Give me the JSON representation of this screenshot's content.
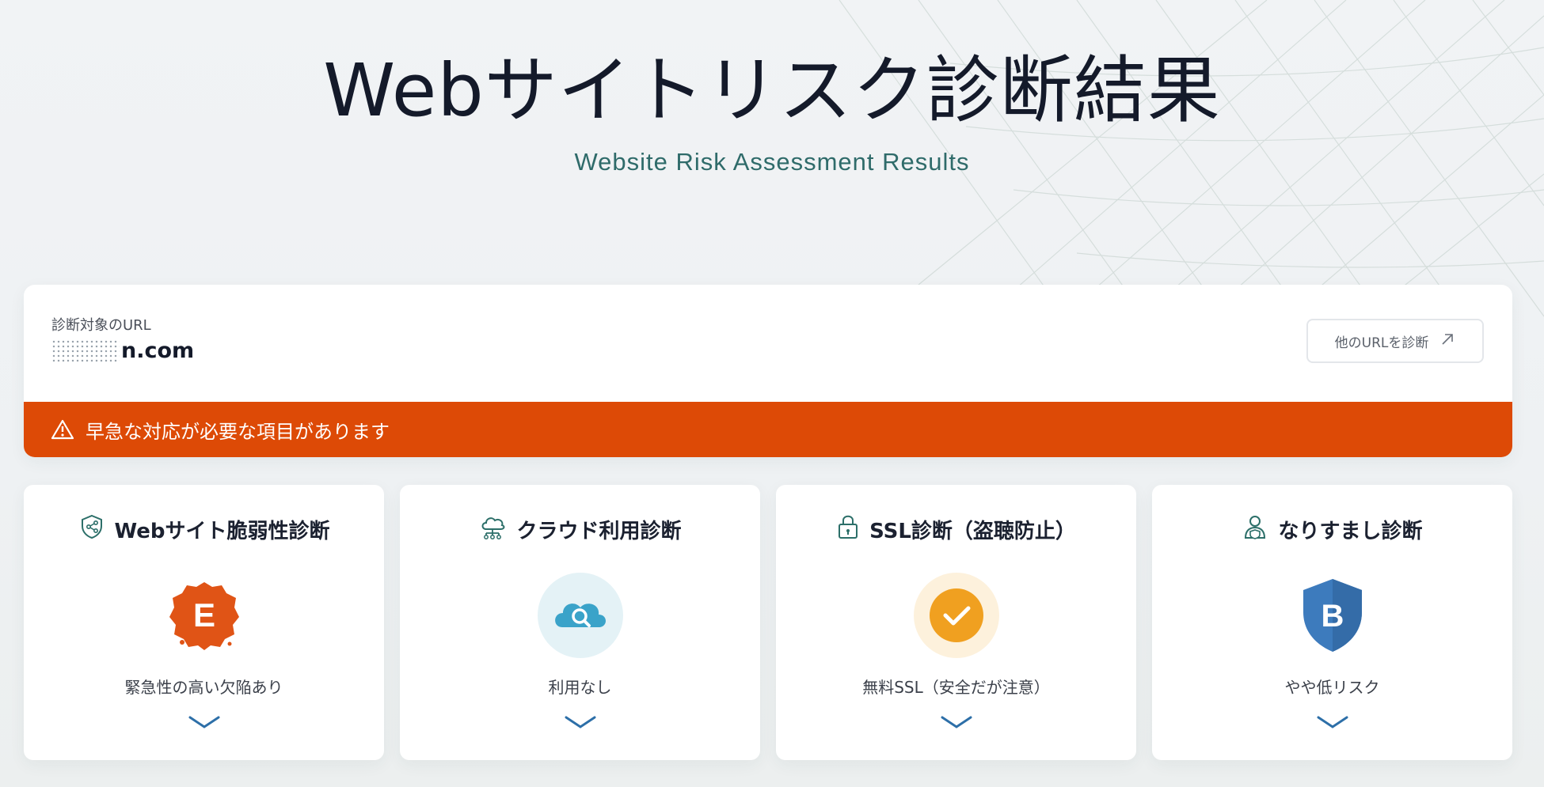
{
  "hero": {
    "title": "Webサイトリスク診断結果",
    "subtitle": "Website Risk Assessment Results"
  },
  "target": {
    "label": "診断対象のURL",
    "url_visible": "n.com",
    "other_url_button": "他のURLを診断"
  },
  "alert": {
    "message": "早急な対応が必要な項目があります",
    "color": "#dd4a06"
  },
  "cards": [
    {
      "title": "Webサイト脆弱性診断",
      "icon": "shield-share-icon",
      "grade": "E",
      "status": "緊急性の高い欠陥あり",
      "color": "#e05416"
    },
    {
      "title": "クラウド利用診断",
      "icon": "cloud-network-icon",
      "grade": "",
      "status": "利用なし",
      "color": "#3aa3c9"
    },
    {
      "title": "SSL診断（盗聴防止）",
      "icon": "lock-icon",
      "grade": "",
      "status": "無料SSL（安全だが注意）",
      "color": "#f0a020"
    },
    {
      "title": "なりすまし診断",
      "icon": "user-shield-icon",
      "grade": "B",
      "status": "やや低リスク",
      "color": "#3d7bbd"
    }
  ]
}
